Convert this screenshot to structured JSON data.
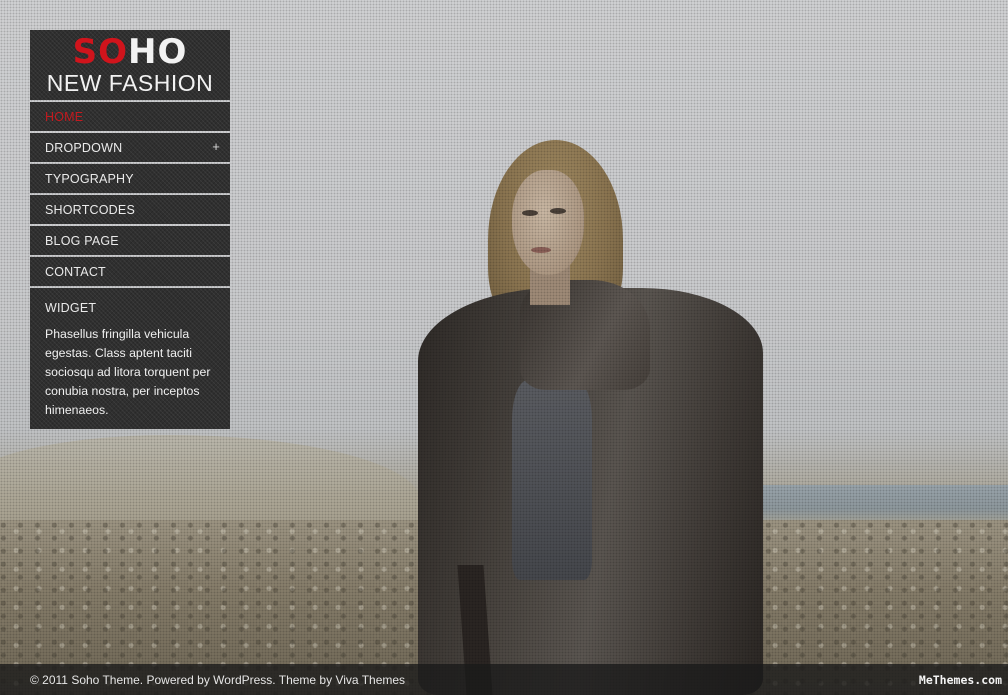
{
  "logo": {
    "mark_part1": "SO",
    "mark_part2": "HO",
    "subtitle": "NEW FASHION"
  },
  "menu": {
    "items": [
      {
        "label": "HOME",
        "active": true
      },
      {
        "label": "DROPDOWN",
        "has_submenu": true,
        "expand_glyph": "+"
      },
      {
        "label": "TYPOGRAPHY"
      },
      {
        "label": "SHORTCODES"
      },
      {
        "label": "BLOG PAGE"
      },
      {
        "label": "CONTACT"
      }
    ]
  },
  "widget": {
    "title": "WIDGET",
    "text": "Phasellus fringilla vehicula egestas. Class aptent taciti sociosqu ad litora torquent per conubia nostra, per inceptos himenaeos."
  },
  "footer": {
    "text": "© 2011 Soho Theme. Powered by WordPress. Theme by Viva Themes",
    "watermark": "MeThemes.com"
  },
  "colors": {
    "accent": "#c21a1f",
    "panel": "#2f2f2f",
    "text": "#eaeaea"
  }
}
